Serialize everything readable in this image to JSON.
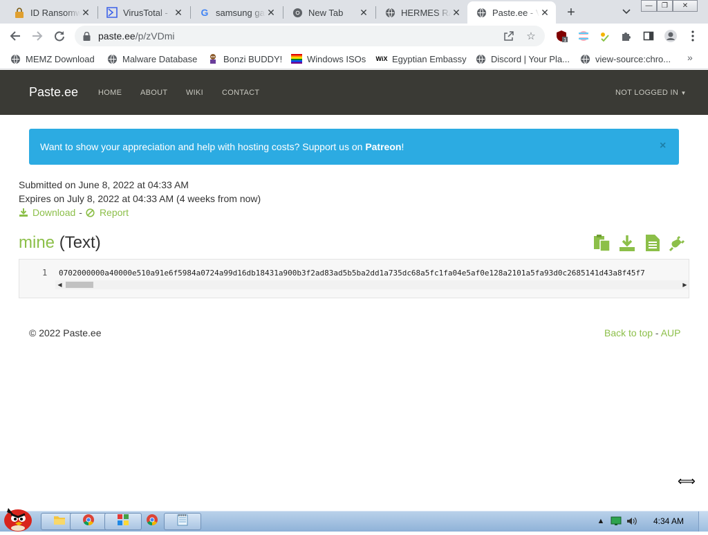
{
  "browser": {
    "tabs": [
      {
        "title": "ID Ransomware",
        "icon": "lock-icon"
      },
      {
        "title": "VirusTotal - ",
        "icon": "virustotal-icon"
      },
      {
        "title": "samsung galaxy",
        "icon": "google-icon"
      },
      {
        "title": "New Tab",
        "icon": "chrome-icon"
      },
      {
        "title": "HERMES RANSOMWARE",
        "icon": "globe-icon"
      },
      {
        "title": "Paste.ee - View",
        "icon": "globe-icon"
      }
    ],
    "window_controls": [
      "minimize",
      "restore",
      "close"
    ],
    "url_host": "paste.ee",
    "url_path": "/p/zVDmi",
    "bookmarks": [
      {
        "label": "MEMZ Download",
        "icon": "globe-icon"
      },
      {
        "label": "Malware Database",
        "icon": "globe-icon"
      },
      {
        "label": "Bonzi BUDDY!",
        "icon": "bonzi-icon"
      },
      {
        "label": "Windows ISOs",
        "icon": "windows-flag-icon"
      },
      {
        "label": "Egyptian Embassy",
        "icon": "wix-icon"
      },
      {
        "label": "Discord | Your Pla...",
        "icon": "globe-icon"
      },
      {
        "label": "view-source:chro...",
        "icon": "globe-icon"
      }
    ],
    "bookmarks_more": "»"
  },
  "site": {
    "brand": "Paste.ee",
    "nav": [
      "HOME",
      "ABOUT",
      "WIKI",
      "CONTACT"
    ],
    "login": "NOT LOGGED IN",
    "alert_text": "Want to show your appreciation and help with hosting costs? Support us on ",
    "alert_link": "Patreon",
    "alert_end": "!",
    "alert_close": "×",
    "submitted": "Submitted on June 8, 2022 at 04:33 AM",
    "expires": "Expires on July 8, 2022 at 04:33 AM (4 weeks from now)",
    "download_label": "Download",
    "report_label": "Report",
    "link_sep": "-",
    "paste_name": "mine",
    "paste_type": "(Text)",
    "line_number": "1",
    "code_line": "0702000000a40000e510a91e6f5984a0724a99d16db18431a900b3f2ad83ad5b5ba2dd1a735dc68a5fc1fa04e5af0e128a2101a5fa93d0c2685141d43a8f45f7",
    "footer_copyright": "© 2022 Paste.ee",
    "footer_back": "Back to top",
    "footer_sep": " - ",
    "footer_aup": "AUP",
    "accent_color": "#8cbf49",
    "alert_color": "#2cabe2",
    "nav_color": "#3a3a35"
  },
  "taskbar": {
    "clock": "4:34 AM",
    "pinned": [
      "explorer-icon",
      "chrome-icon",
      "app-grid-icon",
      "chrome-icon",
      "notepad-icon"
    ]
  }
}
